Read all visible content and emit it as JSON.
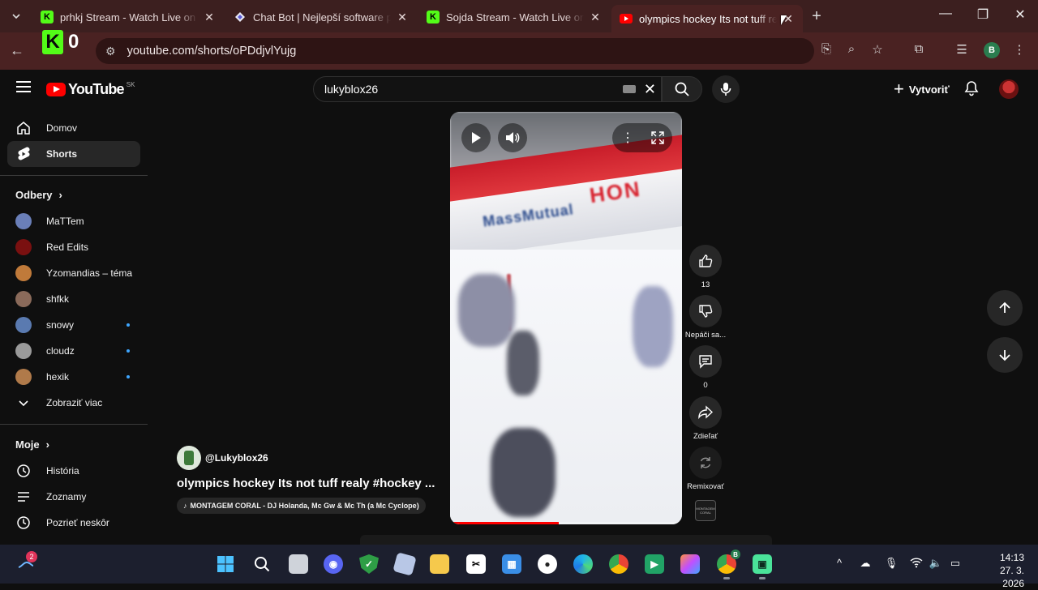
{
  "browser": {
    "tabs": [
      {
        "title": "prhkj Stream - Watch Live on Kick",
        "favicon": "kick-icon",
        "active": false
      },
      {
        "title": "Chat Bot | Nejlepší software pro",
        "favicon": "diamond-icon",
        "active": false
      },
      {
        "title": "Sojda Stream - Watch Live on Kick",
        "favicon": "kick-icon",
        "active": false
      },
      {
        "title": "olympics hockey Its not tuff realy",
        "favicon": "youtube-icon",
        "active": true
      }
    ],
    "url": "youtube.com/shorts/oPDdjvlYujg",
    "profile_initial": "B",
    "kick_overlay": {
      "letter": "K",
      "count": "0"
    }
  },
  "youtube": {
    "logo_text": "YouTube",
    "country_code": "SK",
    "search": {
      "value": "lukyblox26"
    },
    "create_label": "Vytvoriť"
  },
  "sidebar": {
    "main": [
      {
        "label": "Domov",
        "icon": "home-icon",
        "active": false
      },
      {
        "label": "Shorts",
        "icon": "shorts-icon",
        "active": true
      }
    ],
    "subscriptions_title": "Odbery",
    "subscriptions": [
      {
        "label": "MaTTem",
        "new": false,
        "color": "#6a7fb8"
      },
      {
        "label": "Red Edits",
        "new": false,
        "color": "#7a1010"
      },
      {
        "label": "Yzomandias – téma",
        "new": false,
        "color": "#c07a3a"
      },
      {
        "label": "shfkk",
        "new": false,
        "color": "#8a6a5a"
      },
      {
        "label": "snowy",
        "new": true,
        "color": "#5a7ab0"
      },
      {
        "label": "cloudz",
        "new": true,
        "color": "#9a9a9a"
      },
      {
        "label": "hexik",
        "new": true,
        "color": "#b07a4a"
      }
    ],
    "show_more": "Zobraziť viac",
    "you_title": "Moje",
    "you_items": [
      {
        "label": "História",
        "icon": "history-icon"
      },
      {
        "label": "Zoznamy",
        "icon": "playlists-icon"
      },
      {
        "label": "Pozrieť neskôr",
        "icon": "watch-later-icon"
      }
    ]
  },
  "short": {
    "channel": "@Lukyblox26",
    "title": "olympics hockey Its not tuff realy #hockey ...",
    "music": "MONTAGEM CORAL - DJ Holanda, Mc Gw & Mc Th (a Mc Cyclope)",
    "progress": 0.47,
    "board_text": "MassMutual",
    "board_text2": "HON",
    "actions": {
      "like_count": "13",
      "dislike_label": "Nepáči sa...",
      "comment_count": "0",
      "share_label": "Zdieľať",
      "remix_label": "Remixovať"
    },
    "sound_thumb_text": "MONTAGEM CORAL"
  },
  "taskbar": {
    "notification_badge": "2",
    "time": "14:13",
    "date": "27. 3. 2026",
    "chrome_profile": "B"
  }
}
